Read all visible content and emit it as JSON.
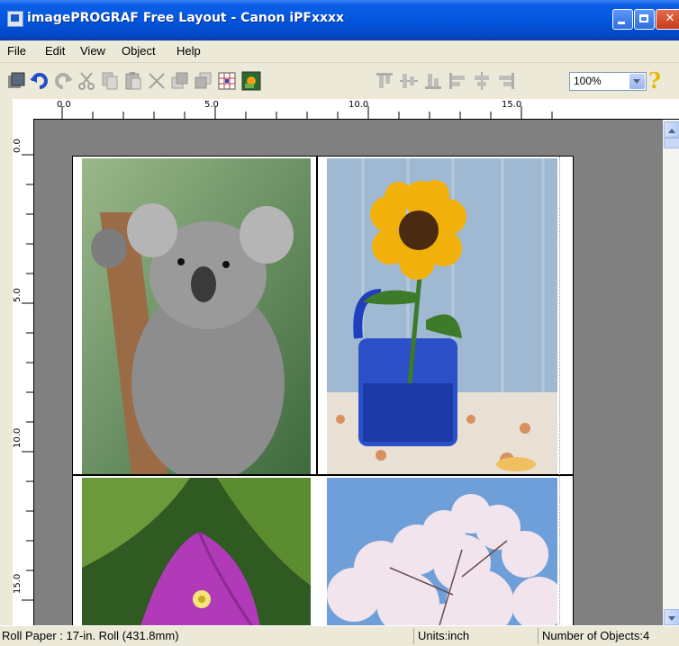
{
  "window": {
    "title": "imagePROGRAF Free Layout - Canon iPFxxxx"
  },
  "menu": {
    "items": [
      "File",
      "Edit",
      "View",
      "Object",
      "Help"
    ]
  },
  "toolbar": {
    "buttons": [
      "open-icon",
      "undo-icon",
      "redo-icon",
      "cut-icon",
      "copy-icon",
      "paste-icon",
      "delete-icon",
      "bring-forward-icon",
      "send-backward-icon",
      "grid-icon",
      "image-icon",
      "align-top-icon",
      "align-vcenter-icon",
      "align-bottom-icon",
      "align-left-icon",
      "align-hcenter-icon",
      "align-right-icon"
    ],
    "zoom_value": "100%"
  },
  "ruler": {
    "h_labels": [
      "0.0",
      "5.0",
      "10.0",
      "15.0"
    ],
    "v_labels": [
      "0.0",
      "5.0",
      "10.0",
      "15.0"
    ]
  },
  "canvas": {
    "photos": [
      {
        "name": "koala-photo"
      },
      {
        "name": "sunflower-photo"
      },
      {
        "name": "bougainvillea-photo"
      },
      {
        "name": "cherry-blossom-photo"
      }
    ]
  },
  "status": {
    "paper": "Roll Paper : 17-in. Roll (431.8mm)",
    "units": "Units:inch",
    "objects": "Number of Objects:4"
  },
  "colors": {
    "titlebar": "#0456de",
    "canvas_bg": "#808080",
    "chrome": "#ece9d8"
  }
}
